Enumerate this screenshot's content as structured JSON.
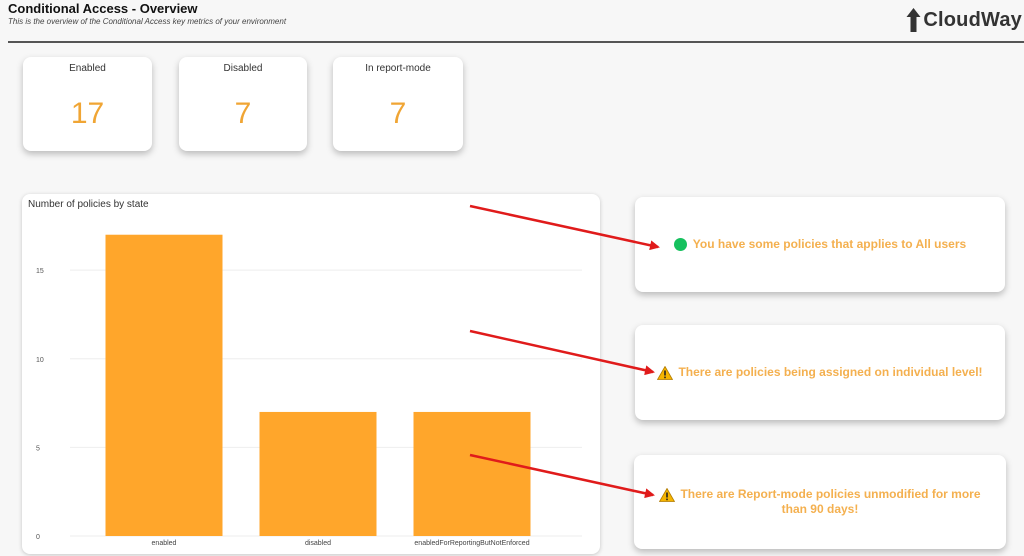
{
  "header": {
    "title": "Conditional Access - Overview",
    "subtitle": "This is the overview of the Conditional Access key metrics of your environment",
    "logo_text": "CloudWay"
  },
  "kpis": [
    {
      "label": "Enabled",
      "value": "17"
    },
    {
      "label": "Disabled",
      "value": "7"
    },
    {
      "label": "In report-mode",
      "value": "7"
    }
  ],
  "alerts": [
    {
      "icon": "green-dot-icon",
      "text": "You have some policies that applies to All users"
    },
    {
      "icon": "warning-icon",
      "text": "There are policies being assigned on individual level!"
    },
    {
      "icon": "warning-icon",
      "text": "There are Report-mode policies unmodified for more than 90 days!"
    }
  ],
  "colors": {
    "accent": "#f0a534",
    "bar": "#ffa62b",
    "ok": "#16c15e",
    "arrow": "#e01b1b"
  },
  "chart_data": {
    "type": "bar",
    "title": "Number of policies by state",
    "categories": [
      "enabled",
      "disabled",
      "enabledForReportingButNotEnforced"
    ],
    "values": [
      17,
      7,
      7
    ],
    "yticks": [
      0,
      5,
      10,
      15
    ],
    "ylim": [
      0,
      18
    ],
    "xlabel": "",
    "ylabel": "",
    "grid": true
  }
}
